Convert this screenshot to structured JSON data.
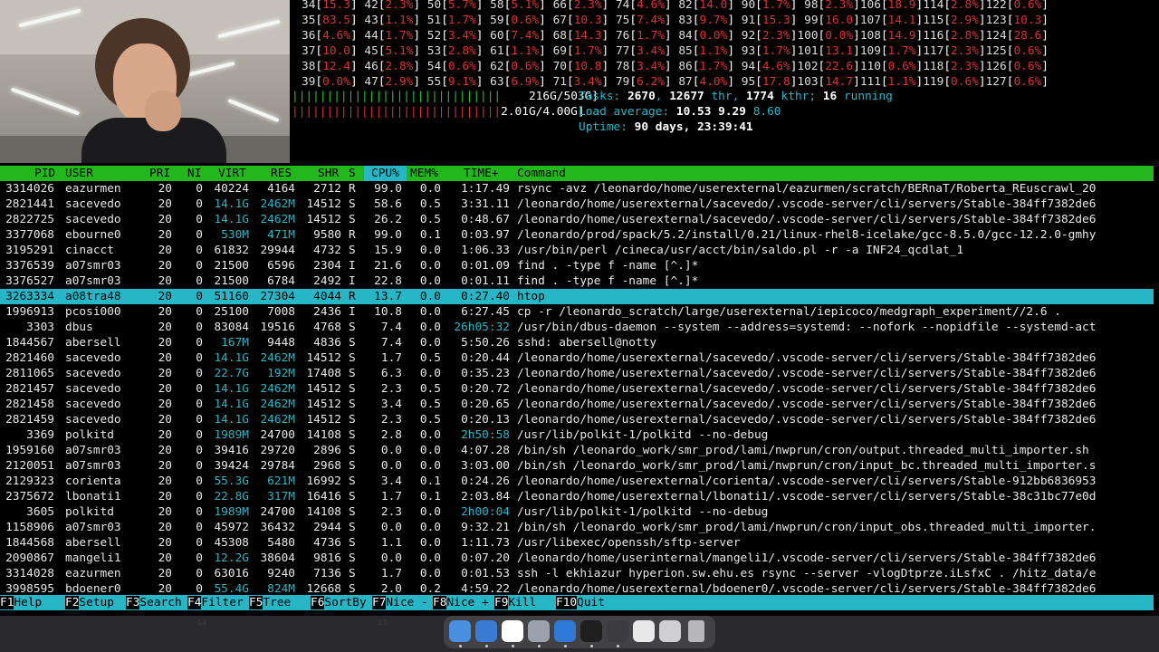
{
  "cpu_rows": [
    [
      [
        "34",
        "15.3"
      ],
      [
        "42",
        "2.3%"
      ],
      [
        "50",
        "5.7%"
      ],
      [
        "58",
        "5.1%"
      ],
      [
        "66",
        "2.3%"
      ],
      [
        "74",
        "4.6%"
      ],
      [
        "82",
        "14.0"
      ],
      [
        "90",
        "1.7%"
      ],
      [
        "98",
        "2.3%"
      ],
      [
        "106",
        "18.9"
      ],
      [
        "114",
        "2.8%"
      ],
      [
        "122",
        "0.6%"
      ]
    ],
    [
      [
        "35",
        "83.5"
      ],
      [
        "43",
        "1.1%"
      ],
      [
        "51",
        "1.7%"
      ],
      [
        "59",
        "0.6%"
      ],
      [
        "67",
        "10.3"
      ],
      [
        "75",
        "7.4%"
      ],
      [
        "83",
        "9.7%"
      ],
      [
        "91",
        "15.3"
      ],
      [
        "99",
        "16.0"
      ],
      [
        "107",
        "14.1"
      ],
      [
        "115",
        "2.9%"
      ],
      [
        "123",
        "10.3"
      ]
    ],
    [
      [
        "36",
        "4.6%"
      ],
      [
        "44",
        "1.7%"
      ],
      [
        "52",
        "3.4%"
      ],
      [
        "60",
        "7.4%"
      ],
      [
        "68",
        "14.3"
      ],
      [
        "76",
        "1.7%"
      ],
      [
        "84",
        "0.0%"
      ],
      [
        "92",
        "2.3%"
      ],
      [
        "100",
        "0.0%"
      ],
      [
        "108",
        "14.9"
      ],
      [
        "116",
        "2.8%"
      ],
      [
        "124",
        "28.6"
      ]
    ],
    [
      [
        "37",
        "10.0"
      ],
      [
        "45",
        "5.1%"
      ],
      [
        "53",
        "2.8%"
      ],
      [
        "61",
        "1.1%"
      ],
      [
        "69",
        "1.7%"
      ],
      [
        "77",
        "3.4%"
      ],
      [
        "85",
        "1.1%"
      ],
      [
        "93",
        "1.7%"
      ],
      [
        "101",
        "13.1"
      ],
      [
        "109",
        "1.7%"
      ],
      [
        "117",
        "2.3%"
      ],
      [
        "125",
        "0.6%"
      ]
    ],
    [
      [
        "38",
        "12.4"
      ],
      [
        "46",
        "2.8%"
      ],
      [
        "54",
        "0.6%"
      ],
      [
        "62",
        "0.6%"
      ],
      [
        "70",
        "10.8"
      ],
      [
        "78",
        "3.4%"
      ],
      [
        "86",
        "1.7%"
      ],
      [
        "94",
        "4.6%"
      ],
      [
        "102",
        "22.6"
      ],
      [
        "110",
        "0.6%"
      ],
      [
        "118",
        "2.3%"
      ],
      [
        "126",
        "0.6%"
      ]
    ],
    [
      [
        "39",
        "0.0%"
      ],
      [
        "47",
        "2.9%"
      ],
      [
        "55",
        "9.1%"
      ],
      [
        "63",
        "6.9%"
      ],
      [
        "71",
        "3.4%"
      ],
      [
        "79",
        "6.2%"
      ],
      [
        "87",
        "4.0%"
      ],
      [
        "95",
        "17.8"
      ],
      [
        "103",
        "14.7"
      ],
      [
        "111",
        "1.1%"
      ],
      [
        "119",
        "0.6%"
      ],
      [
        "127",
        "0.6%"
      ]
    ]
  ],
  "meters": {
    "mem_bar": "||||||||||||||||||||||||||||||",
    "mem_value": "216G/503G]",
    "swp_bar": "||||||||||||||||||||||||||||||",
    "swp_value": "2.01G/4.00G]"
  },
  "summary": {
    "tasks_label": "Tasks:",
    "tasks": "2670",
    "thr": "12677",
    "thr_label": "thr,",
    "kthr": "1774",
    "kthr_label": "kthr;",
    "running": "16",
    "running_label": "running",
    "load_label": "Load average:",
    "load1": "10.53",
    "load5": "9.29",
    "load15": "8.60",
    "uptime_label": "Uptime:",
    "uptime": "90 days, 23:39:41"
  },
  "header": {
    "pid": "PID",
    "user": "USER",
    "pri": "PRI",
    "ni": "NI",
    "virt": "VIRT",
    "res": "RES",
    "shr": "SHR",
    "s": "S",
    "cpu": "CPU%",
    "mem": "MEM%",
    "time": "TIME+",
    "command": "Command"
  },
  "processes": [
    {
      "pid": "3314026",
      "user": "eazurmen",
      "pri": "20",
      "ni": "0",
      "virt": "40224",
      "res": "4164",
      "shr": "2712",
      "s": "R",
      "cpu": "99.0",
      "mem": "0.0",
      "time": "1:17.49",
      "command": "rsync -avz /leonardo/home/userexternal/eazurmen/scratch/BERnaT/Roberta_REuscrawl_20"
    },
    {
      "pid": "2821441",
      "user": "sacevedo",
      "pri": "20",
      "ni": "0",
      "virt": "14.1G",
      "res": "2462M",
      "shr": "14512",
      "s": "S",
      "cpu": "58.6",
      "mem": "0.5",
      "time": "3:31.11",
      "command": "/leonardo/home/userexternal/sacevedo/.vscode-server/cli/servers/Stable-384ff7382de6"
    },
    {
      "pid": "2822725",
      "user": "sacevedo",
      "pri": "20",
      "ni": "0",
      "virt": "14.1G",
      "res": "2462M",
      "shr": "14512",
      "s": "S",
      "cpu": "26.2",
      "mem": "0.5",
      "time": "0:48.67",
      "command": "/leonardo/home/userexternal/sacevedo/.vscode-server/cli/servers/Stable-384ff7382de6"
    },
    {
      "pid": "3377068",
      "user": "ebourne0",
      "pri": "20",
      "ni": "0",
      "virt": "530M",
      "res": "471M",
      "shr": "9580",
      "s": "R",
      "cpu": "99.0",
      "mem": "0.1",
      "time": "0:03.97",
      "command": "/leonardo/prod/spack/5.2/install/0.21/linux-rhel8-icelake/gcc-8.5.0/gcc-12.2.0-gmhy"
    },
    {
      "pid": "3195291",
      "user": "cinacct",
      "pri": "20",
      "ni": "0",
      "virt": "61832",
      "res": "29944",
      "shr": "4732",
      "s": "S",
      "cpu": "15.9",
      "mem": "0.0",
      "time": "1:06.33",
      "command": "/usr/bin/perl /cineca/usr/acct/bin/saldo.pl -r -a INF24_qcdlat_1"
    },
    {
      "pid": "3376539",
      "user": "a07smr03",
      "pri": "20",
      "ni": "0",
      "virt": "21500",
      "res": "6596",
      "shr": "2304",
      "s": "I",
      "cpu": "21.6",
      "mem": "0.0",
      "time": "0:01.09",
      "command": "find . -type f -name [^.]*"
    },
    {
      "pid": "3376527",
      "user": "a07smr03",
      "pri": "20",
      "ni": "0",
      "virt": "21500",
      "res": "6784",
      "shr": "2492",
      "s": "I",
      "cpu": "22.8",
      "mem": "0.0",
      "time": "0:01.11",
      "command": "find . -type f -name [^.]*"
    },
    {
      "pid": "3263334",
      "user": "a08tra48",
      "pri": "20",
      "ni": "0",
      "virt": "51160",
      "res": "27304",
      "shr": "4044",
      "s": "R",
      "cpu": "13.7",
      "mem": "0.0",
      "time": "0:27.40",
      "command": "htop",
      "selected": true
    },
    {
      "pid": "1996913",
      "user": "pcosi000",
      "pri": "20",
      "ni": "0",
      "virt": "25100",
      "res": "7008",
      "shr": "2436",
      "s": "I",
      "cpu": "10.8",
      "mem": "0.0",
      "time": "6:27.45",
      "command": "cp -r /leonardo_scratch/large/userexternal/iepicoco/medgraph_experiment//2.6 ."
    },
    {
      "pid": "3303",
      "user": "dbus",
      "pri": "20",
      "ni": "0",
      "virt": "83084",
      "res": "19516",
      "shr": "4768",
      "s": "S",
      "cpu": "7.4",
      "mem": "0.0",
      "time": "26h05:32",
      "command": "/usr/bin/dbus-daemon --system --address=systemd: --nofork --nopidfile --systemd-act"
    },
    {
      "pid": "1844567",
      "user": "abersell",
      "pri": "20",
      "ni": "0",
      "virt": "167M",
      "res": "9448",
      "shr": "4836",
      "s": "S",
      "cpu": "7.4",
      "mem": "0.0",
      "time": "5:50.26",
      "command": "sshd: abersell@notty"
    },
    {
      "pid": "2821460",
      "user": "sacevedo",
      "pri": "20",
      "ni": "0",
      "virt": "14.1G",
      "res": "2462M",
      "shr": "14512",
      "s": "S",
      "cpu": "1.7",
      "mem": "0.5",
      "time": "0:20.44",
      "command": "/leonardo/home/userexternal/sacevedo/.vscode-server/cli/servers/Stable-384ff7382de6"
    },
    {
      "pid": "2811065",
      "user": "sacevedo",
      "pri": "20",
      "ni": "0",
      "virt": "22.7G",
      "res": "192M",
      "shr": "17408",
      "s": "S",
      "cpu": "6.3",
      "mem": "0.0",
      "time": "0:35.23",
      "command": "/leonardo/home/userexternal/sacevedo/.vscode-server/cli/servers/Stable-384ff7382de6"
    },
    {
      "pid": "2821457",
      "user": "sacevedo",
      "pri": "20",
      "ni": "0",
      "virt": "14.1G",
      "res": "2462M",
      "shr": "14512",
      "s": "S",
      "cpu": "2.3",
      "mem": "0.5",
      "time": "0:20.72",
      "command": "/leonardo/home/userexternal/sacevedo/.vscode-server/cli/servers/Stable-384ff7382de6"
    },
    {
      "pid": "2821458",
      "user": "sacevedo",
      "pri": "20",
      "ni": "0",
      "virt": "14.1G",
      "res": "2462M",
      "shr": "14512",
      "s": "S",
      "cpu": "3.4",
      "mem": "0.5",
      "time": "0:20.65",
      "command": "/leonardo/home/userexternal/sacevedo/.vscode-server/cli/servers/Stable-384ff7382de6"
    },
    {
      "pid": "2821459",
      "user": "sacevedo",
      "pri": "20",
      "ni": "0",
      "virt": "14.1G",
      "res": "2462M",
      "shr": "14512",
      "s": "S",
      "cpu": "2.3",
      "mem": "0.5",
      "time": "0:20.13",
      "command": "/leonardo/home/userexternal/sacevedo/.vscode-server/cli/servers/Stable-384ff7382de6"
    },
    {
      "pid": "3369",
      "user": "polkitd",
      "pri": "20",
      "ni": "0",
      "virt": "1989M",
      "res": "24700",
      "shr": "14108",
      "s": "S",
      "cpu": "2.8",
      "mem": "0.0",
      "time": "2h50:58",
      "command": "/usr/lib/polkit-1/polkitd --no-debug"
    },
    {
      "pid": "1959160",
      "user": "a07smr03",
      "pri": "20",
      "ni": "0",
      "virt": "39416",
      "res": "29720",
      "shr": "2896",
      "s": "S",
      "cpu": "0.0",
      "mem": "0.0",
      "time": "4:07.28",
      "command": "/bin/sh /leonardo_work/smr_prod/lami/nwprun/cron/output.threaded_multi_importer.sh"
    },
    {
      "pid": "2120051",
      "user": "a07smr03",
      "pri": "20",
      "ni": "0",
      "virt": "39424",
      "res": "29784",
      "shr": "2968",
      "s": "S",
      "cpu": "0.0",
      "mem": "0.0",
      "time": "3:03.00",
      "command": "/bin/sh /leonardo_work/smr_prod/lami/nwprun/cron/input_bc.threaded_multi_importer.s"
    },
    {
      "pid": "2129323",
      "user": "corienta",
      "pri": "20",
      "ni": "0",
      "virt": "55.3G",
      "res": "621M",
      "shr": "16992",
      "s": "S",
      "cpu": "3.4",
      "mem": "0.1",
      "time": "0:24.26",
      "command": "/leonardo/home/userexternal/corienta/.vscode-server/cli/servers/Stable-912bb6836953"
    },
    {
      "pid": "2375672",
      "user": "lbonati1",
      "pri": "20",
      "ni": "0",
      "virt": "22.8G",
      "res": "317M",
      "shr": "16416",
      "s": "S",
      "cpu": "1.7",
      "mem": "0.1",
      "time": "2:03.84",
      "command": "/leonardo/home/userexternal/lbonati1/.vscode-server/cli/servers/Stable-38c31bc77e0d"
    },
    {
      "pid": "3605",
      "user": "polkitd",
      "pri": "20",
      "ni": "0",
      "virt": "1989M",
      "res": "24700",
      "shr": "14108",
      "s": "S",
      "cpu": "2.3",
      "mem": "0.0",
      "time": "2h00:04",
      "command": "/usr/lib/polkit-1/polkitd --no-debug"
    },
    {
      "pid": "1158906",
      "user": "a07smr03",
      "pri": "20",
      "ni": "0",
      "virt": "45972",
      "res": "36432",
      "shr": "2944",
      "s": "S",
      "cpu": "0.0",
      "mem": "0.0",
      "time": "9:32.21",
      "command": "/bin/sh /leonardo_work/smr_prod/lami/nwprun/cron/input_obs.threaded_multi_importer."
    },
    {
      "pid": "1844568",
      "user": "abersell",
      "pri": "20",
      "ni": "0",
      "virt": "45308",
      "res": "5480",
      "shr": "4736",
      "s": "S",
      "cpu": "1.1",
      "mem": "0.0",
      "time": "1:11.73",
      "command": "/usr/libexec/openssh/sftp-server"
    },
    {
      "pid": "2090867",
      "user": "mangeli1",
      "pri": "20",
      "ni": "0",
      "virt": "12.2G",
      "res": "38604",
      "shr": "9816",
      "s": "S",
      "cpu": "0.0",
      "mem": "0.0",
      "time": "0:07.20",
      "command": "/leonardo/home/userinternal/mangeli1/.vscode-server/cli/servers/Stable-384ff7382de6"
    },
    {
      "pid": "3314028",
      "user": "eazurmen",
      "pri": "20",
      "ni": "0",
      "virt": "63016",
      "res": "9240",
      "shr": "7136",
      "s": "S",
      "cpu": "1.7",
      "mem": "0.0",
      "time": "0:01.53",
      "command": "ssh -l ekhiazur hyperion.sw.ehu.es rsync --server -vlogDtprze.iLsfxC . /hitz_data/e"
    },
    {
      "pid": "3998595",
      "user": "bdoener0",
      "pri": "20",
      "ni": "0",
      "virt": "55.4G",
      "res": "824M",
      "shr": "12668",
      "s": "S",
      "cpu": "2.0",
      "mem": "0.2",
      "time": "4:59.22",
      "command": "/leonardo/home/userexternal/bdoener0/.vscode-server/cli/servers/Stable-384ff7382de6"
    }
  ],
  "footer": [
    {
      "key": "F1",
      "label": "Help"
    },
    {
      "key": "F2",
      "label": "Setup"
    },
    {
      "key": "F3",
      "label": "Search"
    },
    {
      "key": "F4",
      "label": "Filter"
    },
    {
      "key": "F5",
      "label": "Tree"
    },
    {
      "key": "F6",
      "label": "SortBy"
    },
    {
      "key": "F7",
      "label": "Nice -"
    },
    {
      "key": "F8",
      "label": "Nice +"
    },
    {
      "key": "F9",
      "label": "Kill"
    },
    {
      "key": "F10",
      "label": "Quit"
    }
  ],
  "dock_icons": [
    "finder-icon",
    "safari-icon",
    "chatgpt-icon",
    "system-info-icon",
    "vscode-icon",
    "terminal-icon",
    "screen-recorder-icon",
    "preview-icon",
    "screenshot-icon",
    "trash-icon"
  ],
  "colors": {
    "meter_green": "#22c52a",
    "meter_red": "#e03030",
    "cyan": "#27b6c6",
    "header_green": "#22b81c"
  }
}
